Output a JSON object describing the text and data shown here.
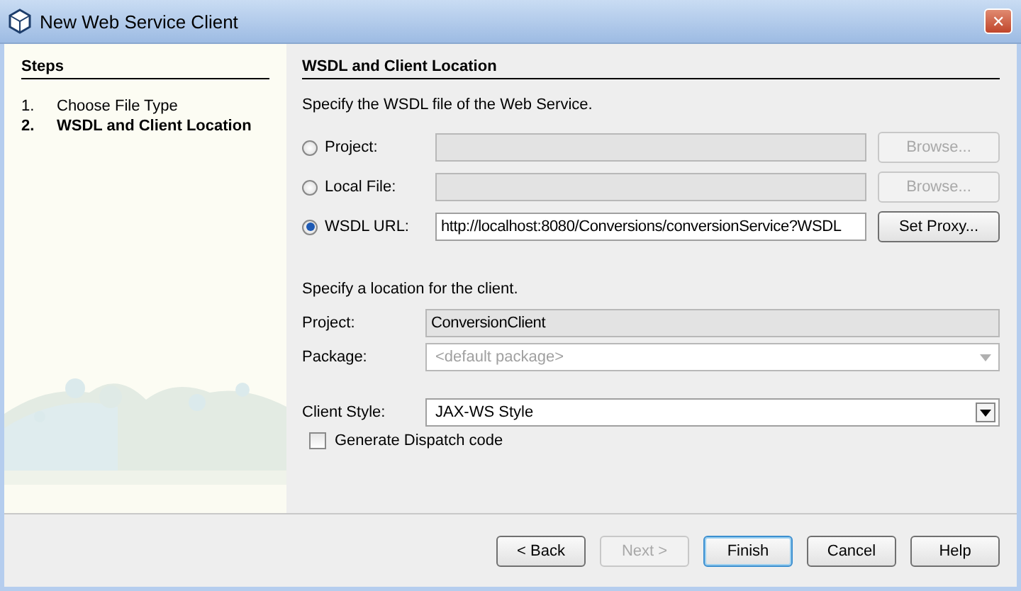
{
  "window": {
    "title": "New Web Service Client",
    "close": "✕"
  },
  "steps": {
    "title": "Steps",
    "items": [
      {
        "number": "1.",
        "label": "Choose File Type",
        "selected": false
      },
      {
        "number": "2.",
        "label": "WSDL and Client Location",
        "selected": true
      }
    ]
  },
  "panel": {
    "title": "WSDL and Client Location",
    "description": "Specify the WSDL file of the Web Service.",
    "sources": [
      {
        "label": "Project:",
        "selected": false,
        "disabled": true,
        "button": {
          "label": "Browse...",
          "disabled": true
        }
      },
      {
        "label": "Local File:",
        "selected": false,
        "disabled": true,
        "button": {
          "label": "Browse...",
          "disabled": true
        }
      },
      {
        "label": "WSDL URL:",
        "selected": true,
        "value": "http://localhost:8080/Conversions/conversionService?WSDL",
        "disabled": false,
        "button": {
          "label": "Set Proxy...",
          "disabled": false
        }
      }
    ],
    "location_description": "Specify a location for the client.",
    "project": {
      "label": "Project:",
      "value": "ConversionClient"
    },
    "package": {
      "label": "Package:",
      "value": "<default package>",
      "disabled": true
    },
    "client_style": {
      "label": "Client Style:",
      "value": "JAX-WS Style",
      "disabled": false
    },
    "dispatch": {
      "label": "Generate Dispatch code",
      "checked": false
    }
  },
  "buttons": [
    {
      "label": "< Back",
      "disabled": false,
      "default": false
    },
    {
      "label": "Next >",
      "disabled": true,
      "default": false
    },
    {
      "label": "Finish",
      "disabled": false,
      "default": true
    },
    {
      "label": "Cancel",
      "disabled": false,
      "default": false
    },
    {
      "label": "Help",
      "disabled": false,
      "default": false
    }
  ]
}
